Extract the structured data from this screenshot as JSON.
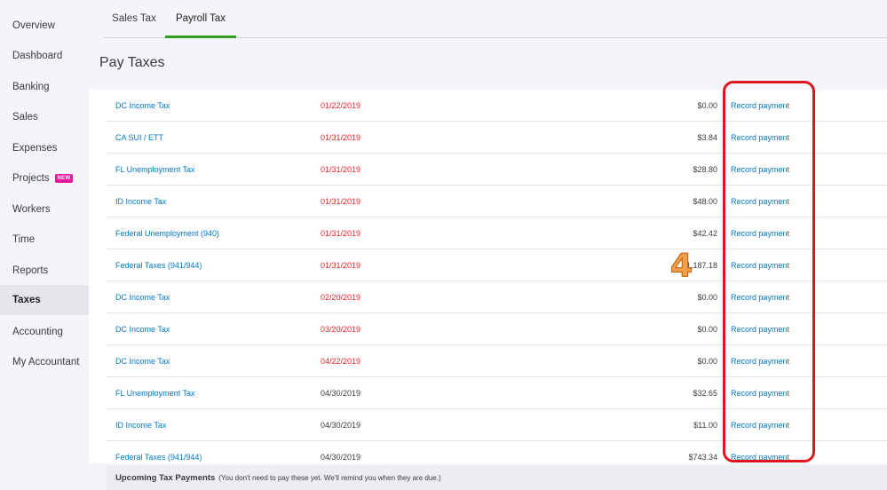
{
  "sidebar": {
    "items": [
      {
        "label": "Overview"
      },
      {
        "label": "Dashboard"
      },
      {
        "label": "Banking"
      },
      {
        "label": "Sales"
      },
      {
        "label": "Expenses"
      },
      {
        "label": "Projects",
        "badge": "NEW"
      },
      {
        "label": "Workers"
      },
      {
        "label": "Time"
      },
      {
        "label": "Reports"
      },
      {
        "label": "Taxes",
        "active": true
      },
      {
        "label": "Accounting"
      },
      {
        "label": "My Accountant"
      }
    ]
  },
  "tabs": [
    {
      "label": "Sales Tax"
    },
    {
      "label": "Payroll Tax",
      "active": true
    }
  ],
  "page_title": "Pay Taxes",
  "rows": [
    {
      "name": "DC Income Tax",
      "due": "01/22/2019",
      "overdue": true,
      "amount": "$0.00",
      "action": "Record payment"
    },
    {
      "name": "CA SUI / ETT",
      "due": "01/31/2019",
      "overdue": true,
      "amount": "$3.84",
      "action": "Record payment"
    },
    {
      "name": "FL Unemployment Tax",
      "due": "01/31/2019",
      "overdue": true,
      "amount": "$28.80",
      "action": "Record payment"
    },
    {
      "name": "ID Income Tax",
      "due": "01/31/2019",
      "overdue": true,
      "amount": "$48.00",
      "action": "Record payment"
    },
    {
      "name": "Federal Unemployment (940)",
      "due": "01/31/2019",
      "overdue": true,
      "amount": "$42.42",
      "action": "Record payment"
    },
    {
      "name": "Federal Taxes (941/944)",
      "due": "01/31/2019",
      "overdue": true,
      "amount": "$1,187.18",
      "action": "Record payment"
    },
    {
      "name": "DC Income Tax",
      "due": "02/20/2019",
      "overdue": true,
      "amount": "$0.00",
      "action": "Record payment"
    },
    {
      "name": "DC Income Tax",
      "due": "03/20/2019",
      "overdue": true,
      "amount": "$0.00",
      "action": "Record payment"
    },
    {
      "name": "DC Income Tax",
      "due": "04/22/2019",
      "overdue": true,
      "amount": "$0.00",
      "action": "Record payment"
    },
    {
      "name": "FL Unemployment Tax",
      "due": "04/30/2019",
      "overdue": false,
      "amount": "$32.65",
      "action": "Record payment"
    },
    {
      "name": "ID Income Tax",
      "due": "04/30/2019",
      "overdue": false,
      "amount": "$11.00",
      "action": "Record payment"
    },
    {
      "name": "Federal Taxes (941/944)",
      "due": "04/30/2019",
      "overdue": false,
      "amount": "$743.34",
      "action": "Record payment"
    }
  ],
  "upcoming": {
    "title": "Upcoming Tax Payments",
    "note": "(You don't need to pay these yet. We'll remind you when they are due.)"
  },
  "annotation": {
    "step_number": "4",
    "highlight_color": "#e0141f",
    "step_color": "#f0a04a"
  },
  "colors": {
    "link": "#0077c5",
    "overdue": "#e52424",
    "tab_accent": "#2ca01c",
    "badge": "#e3179a"
  }
}
